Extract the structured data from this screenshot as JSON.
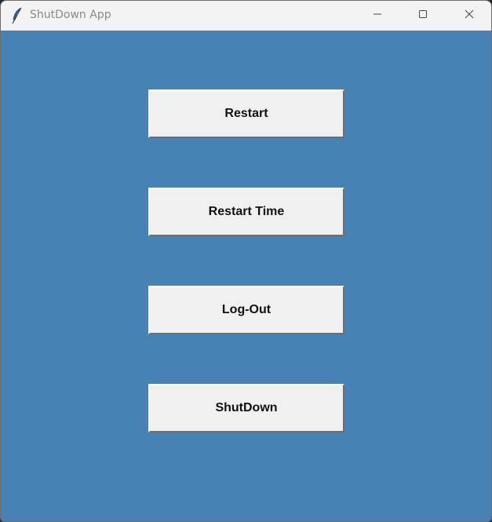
{
  "window": {
    "title": "ShutDown App",
    "app_icon": "feather-icon",
    "controls": {
      "minimize_icon": "minimize-icon",
      "maximize_icon": "maximize-icon",
      "close_icon": "close-icon"
    }
  },
  "main": {
    "background_color": "#4682b4",
    "buttons": [
      {
        "label": "Restart"
      },
      {
        "label": "Restart Time"
      },
      {
        "label": "Log-Out"
      },
      {
        "label": "ShutDown"
      }
    ]
  }
}
